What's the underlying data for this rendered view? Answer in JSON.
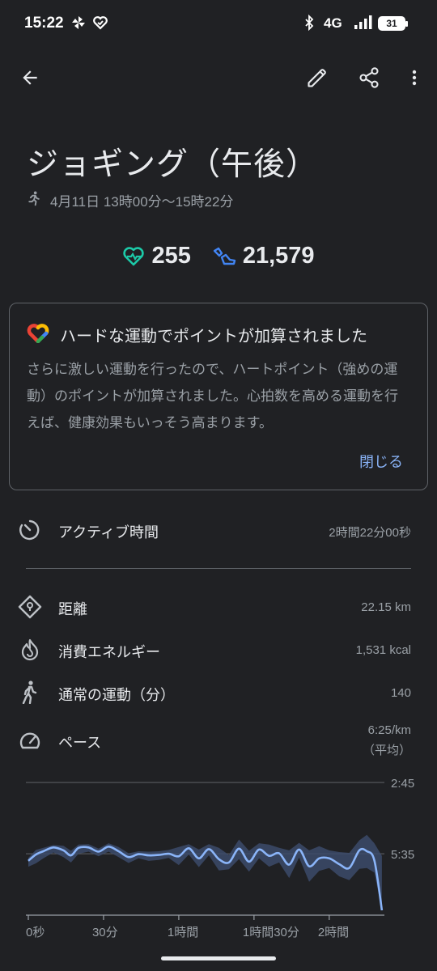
{
  "status_bar": {
    "time": "15:22",
    "network": "4G",
    "battery": "31",
    "icons": [
      "pinwheel-icon",
      "heart-check-icon",
      "bluetooth-icon",
      "signal-icon",
      "battery-icon"
    ]
  },
  "app_bar": {
    "icons": [
      "back-arrow-icon",
      "edit-icon",
      "share-icon",
      "more-vert-icon"
    ]
  },
  "activity": {
    "title": "ジョギング（午後）",
    "time_range": "4月11日 13時00分〜15時22分",
    "heart_points": "255",
    "steps": "21,579"
  },
  "colors": {
    "background": "#202124",
    "heart_points": "#1ccaa8",
    "steps": "#4285f4",
    "link": "#8ab4f8",
    "chart_line": "#8ab4f8",
    "chart_band": "#3c4a6a"
  },
  "notice": {
    "title": "ハードな運動でポイントが加算されました",
    "body": "さらに激しい運動を行ったので、ハートポイント（強めの運動）のポイントが加算されました。心拍数を高める運動を行えば、健康効果もいっそう高まります。",
    "close_label": "閉じる"
  },
  "metrics": {
    "active_time": {
      "label": "アクティブ時間",
      "value": "2時間22分00秒"
    },
    "distance": {
      "label": "距離",
      "value": "22.15 km"
    },
    "calories": {
      "label": "消費エネルギー",
      "value": "1,531 kcal"
    },
    "move_minutes": {
      "label": "通常の運動（分）",
      "value": "140"
    },
    "pace": {
      "label": "ペース",
      "value": "6:25/km",
      "value_note": "（平均）"
    }
  },
  "chart_data": {
    "type": "area",
    "title": "",
    "xlabel": "",
    "ylabel": "",
    "x_ticks": [
      "0秒",
      "30分",
      "1時間",
      "1時間30分",
      "2時間"
    ],
    "x_tick_minutes": [
      0,
      30,
      60,
      90,
      120
    ],
    "x_range_minutes": [
      0,
      142
    ],
    "y_ticks": [
      "2:45",
      "5:35"
    ],
    "y_tick_seconds_per_km": [
      165,
      335
    ],
    "y_range_seconds_per_km": [
      165,
      470
    ],
    "y_inverted": true,
    "grid": true,
    "series": [
      {
        "x_minutes": [
          0,
          3,
          6,
          10,
          14,
          17,
          20,
          24,
          28,
          32,
          36,
          40,
          44,
          48,
          52,
          56,
          60,
          64,
          68,
          72,
          76,
          80,
          84,
          88,
          92,
          96,
          100,
          104,
          108,
          112,
          116,
          120,
          124,
          128,
          132,
          135,
          138,
          141
        ],
        "pace_seconds_per_km": [
          352,
          337,
          329,
          320,
          327,
          339,
          321,
          320,
          330,
          318,
          329,
          343,
          336,
          339,
          338,
          335,
          341,
          322,
          346,
          324,
          348,
          356,
          323,
          354,
          325,
          340,
          334,
          361,
          325,
          365,
          346,
          346,
          360,
          369,
          327,
          329,
          351,
          470
        ],
        "band_low": [
          345,
          326,
          321,
          314,
          316,
          328,
          313,
          312,
          323,
          310,
          319,
          334,
          329,
          330,
          329,
          326,
          319,
          312,
          325,
          312,
          321,
          338,
          301,
          328,
          310,
          313,
          321,
          327,
          309,
          327,
          317,
          327,
          331,
          333,
          303,
          290,
          310,
          340
        ],
        "band_high": [
          366,
          358,
          346,
          332,
          343,
          356,
          335,
          330,
          341,
          330,
          343,
          357,
          346,
          352,
          350,
          345,
          362,
          337,
          367,
          339,
          375,
          372,
          348,
          378,
          346,
          366,
          356,
          393,
          344,
          402,
          376,
          369,
          389,
          398,
          371,
          369,
          380,
          470
        ]
      }
    ]
  }
}
